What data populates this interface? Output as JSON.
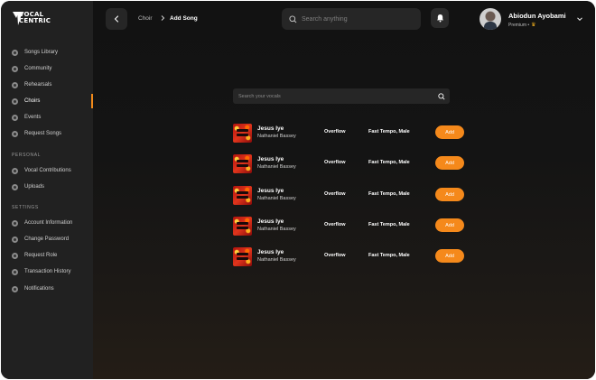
{
  "brand": {
    "logo_line1": "VOCAL",
    "logo_line2": "CENTRIC",
    "accent": "#f5891b"
  },
  "sidebar": {
    "main_items": [
      {
        "label": "Songs Library",
        "icon": "music-icon",
        "active": false
      },
      {
        "label": "Community",
        "icon": "community-icon",
        "active": false
      },
      {
        "label": "Rehearsals",
        "icon": "rehearsal-icon",
        "active": false
      },
      {
        "label": "Choirs",
        "icon": "choir-icon",
        "active": true
      },
      {
        "label": "Events",
        "icon": "calendar-icon",
        "active": false
      },
      {
        "label": "Request Songs",
        "icon": "request-icon",
        "active": false
      }
    ],
    "personal_title": "PERSONAL",
    "personal_items": [
      {
        "label": "Vocal Contributions",
        "icon": "microphone-icon"
      },
      {
        "label": "Uploads",
        "icon": "upload-icon"
      }
    ],
    "settings_title": "SETTINGS",
    "settings_items": [
      {
        "label": "Account Information",
        "icon": "account-icon"
      },
      {
        "label": "Change Password",
        "icon": "lock-icon"
      },
      {
        "label": "Request Role",
        "icon": "role-icon"
      },
      {
        "label": "Transaction History",
        "icon": "history-icon"
      },
      {
        "label": "Notifications",
        "icon": "notification-icon"
      }
    ]
  },
  "header": {
    "breadcrumb": [
      "Choir",
      "Add Song"
    ],
    "search_placeholder": "Search anything",
    "user_name": "Abiodun Ayobami",
    "user_plan": "Premium •"
  },
  "content": {
    "search_placeholder": "Search your vocals",
    "songs": [
      {
        "title": "Jesus Iye",
        "artist": "Nathaniel Bassey",
        "part": "Overflow",
        "style": "Fast Tempo, Male",
        "action": "Add"
      },
      {
        "title": "Jesus Iye",
        "artist": "Nathaniel Bassey",
        "part": "Overflow",
        "style": "Fast Tempo, Male",
        "action": "Add"
      },
      {
        "title": "Jesus Iye",
        "artist": "Nathaniel Bassey",
        "part": "Overflow",
        "style": "Fast Tempo, Male",
        "action": "Add"
      },
      {
        "title": "Jesus Iye",
        "artist": "Nathaniel Bassey",
        "part": "Overflow",
        "style": "Fast Tempo, Male",
        "action": "Add"
      },
      {
        "title": "Jesus Iye",
        "artist": "Nathaniel Bassey",
        "part": "Overflow",
        "style": "Fast Tempo, Male",
        "action": "Add"
      }
    ]
  }
}
